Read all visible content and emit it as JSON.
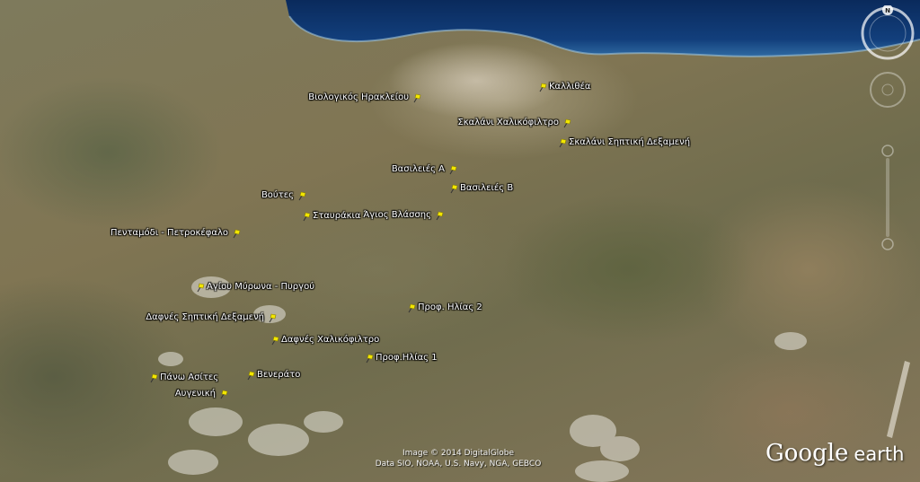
{
  "map": {
    "places": [
      {
        "name": "Βιολογικός Ηρακλείου",
        "side": "left"
      },
      {
        "name": "Καλλιθέα",
        "side": "right"
      },
      {
        "name": "Σκαλάνι Χαλικόφιλτρο",
        "side": "left"
      },
      {
        "name": "Σκαλάνι Σηπτική Δεξαμενή",
        "side": "right"
      },
      {
        "name": "Βασιλειές Α",
        "side": "left"
      },
      {
        "name": "Βασιλειές Β",
        "side": "right"
      },
      {
        "name": "Βούτες",
        "side": "left"
      },
      {
        "name": "Σταυράκια",
        "side": "right"
      },
      {
        "name": "Άγιος Βλάσσης",
        "side": "left"
      },
      {
        "name": "Πενταμόδι - Πετροκέφαλο",
        "side": "left"
      },
      {
        "name": "Αγίου Μύρωνα - Πυργού",
        "side": "right"
      },
      {
        "name": "Δαφνές Σηπτική Δεξαμενή",
        "side": "left"
      },
      {
        "name": "Προφ. Ηλίας 2",
        "side": "right"
      },
      {
        "name": "Δαφνές Χαλικόφιλτρο",
        "side": "right"
      },
      {
        "name": "Προφ.Ηλίας 1",
        "side": "right"
      },
      {
        "name": "Πάνω Ασίτες",
        "side": "right"
      },
      {
        "name": "Βενεράτο",
        "side": "right"
      },
      {
        "name": "Αυγενική",
        "side": "left"
      }
    ]
  },
  "attribution": {
    "line1": "Image © 2014 DigitalGlobe",
    "line2": "Data SIO, NOAA, U.S. Navy, NGA, GEBCO"
  },
  "logo": {
    "brand": "Google",
    "product": "earth"
  },
  "controls": {
    "compass_letter": "N"
  },
  "colors": {
    "pin": "#f2e600",
    "sea_deep": "#0b2f63",
    "sea_shallow": "#2e6aa3",
    "label_text": "#ffffff"
  }
}
